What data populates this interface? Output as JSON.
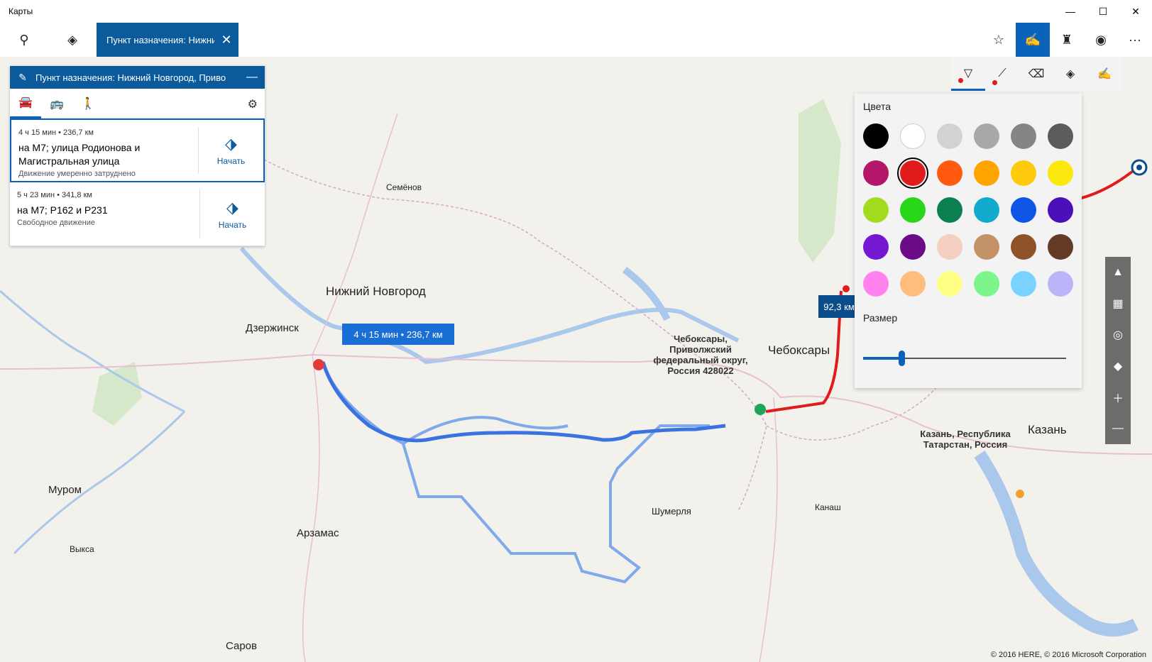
{
  "window": {
    "title": "Карты",
    "min_icon": "minimize-icon",
    "max_icon": "maximize-icon",
    "close_icon": "close-icon"
  },
  "toolbar": {
    "search_icon": "search-icon",
    "directions_icon": "directions-icon",
    "destination_tab": "Пункт назначения: Нижний",
    "favorites_icon": "star-icon",
    "ink_icon": "ink-toolbar-icon",
    "landmarks_icon": "landmarks-icon",
    "traffic_icon": "traffic-icon",
    "more": "···"
  },
  "directions": {
    "header": "Пункт назначения: Нижний Новгород, Приво",
    "modes": [
      "car-icon",
      "bus-icon",
      "walk-icon"
    ],
    "routes": [
      {
        "time": "4 ч 15 мин",
        "dist": "236,7 км",
        "name": "на М7; улица Родионова и Магистральная улица",
        "status": "Движение умеренно затруднено",
        "start": "Начать"
      },
      {
        "time": "5 ч 23 мин",
        "dist": "341,8 км",
        "name": "на М7; Р162 и Р231",
        "status": "Свободное движение",
        "start": "Начать"
      }
    ]
  },
  "ink": {
    "tools": [
      "ballpoint-pen-icon",
      "ruler-pen-icon",
      "eraser-icon",
      "route-icon",
      "touch-write-icon"
    ],
    "colors_label": "Цвета",
    "size_label": "Размер",
    "palette": [
      "#000000",
      "#ffffff",
      "#d2d2d2",
      "#a8a8a8",
      "#858585",
      "#5b5b5b",
      "#b4176a",
      "#e01b1b",
      "#ff5a0f",
      "#ffa500",
      "#ffc90e",
      "#fce80c",
      "#a2dc1e",
      "#28d61a",
      "#0c7e4f",
      "#11aacc",
      "#0d56e6",
      "#4a0fb8",
      "#7418d1",
      "#6b0b86",
      "#f5cfc0",
      "#c39267",
      "#8f5329",
      "#633a26",
      "#ff82ef",
      "#ffbe80",
      "#ffff88",
      "#7cf58c",
      "#7ad2ff",
      "#bcb4f8"
    ],
    "selected_index": 7,
    "size_fraction": 0.2
  },
  "map": {
    "route_bubble": "4 ч 15 мин  •  236,7 км",
    "distance_bubble": "92,3 км",
    "copyright": "© 2016 HERE, © 2016 Microsoft Corporation",
    "cities": {
      "nn": "Нижний Новгород",
      "dzerzhinsk": "Дзержинск",
      "cheb": "Чебоксары",
      "kazan": "Казань",
      "arzamas": "Арзамас",
      "murom": "Муром",
      "sarov": "Саров",
      "semenov": "Семёнов",
      "shumerlya": "Шумерля",
      "vyksa": "Выкса",
      "kanash": "Канаш"
    },
    "dest_label": "Чебоксары, Приволжский федеральный округ, Россия 428022",
    "kazan_label": "Казань, Республика Татарстан, Россия"
  }
}
